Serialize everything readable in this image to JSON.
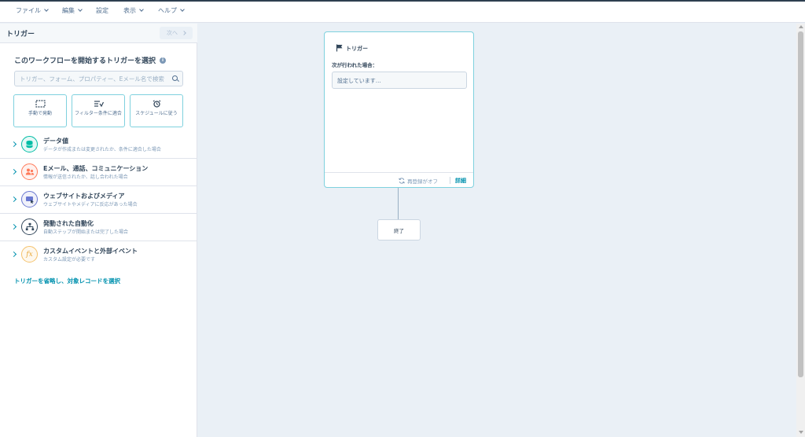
{
  "menu": {
    "file": "ファイル",
    "edit": "編集",
    "settings": "設定",
    "view": "表示",
    "help": "ヘルプ"
  },
  "panel": {
    "title": "トリガー",
    "next_label": "次へ",
    "heading": "このワークフローを開始するトリガーを選択",
    "search_placeholder": "トリガー、フォーム、プロパティー、Eメール名で検索"
  },
  "tiles": [
    {
      "label": "手動で発動",
      "icon": "manual-trigger-icon"
    },
    {
      "label": "フィルター条件に適合",
      "icon": "filter-icon"
    },
    {
      "label": "スケジュールに従う",
      "icon": "alarm-clock-icon"
    }
  ],
  "categories": [
    {
      "title": "データ値",
      "desc": "データが作成または変更されたか、条件に適合した場合",
      "icon": "database-icon",
      "color": "#00bda5"
    },
    {
      "title": "Eメール、通話、コミュニケーション",
      "desc": "情報が送信されたか、話し合われた場合",
      "icon": "people-icon",
      "color": "#ff7a59"
    },
    {
      "title": "ウェブサイトおよびメディア",
      "desc": "ウェブサイトやメディアに反応があった場合",
      "icon": "website-icon",
      "color": "#6a78d1"
    },
    {
      "title": "発動された自動化",
      "desc": "自動ステップが開始または完了した場合",
      "icon": "workflow-icon",
      "color": "#33475b"
    },
    {
      "title": "カスタムイベントと外部イベント",
      "desc": "カスタム設定が必要です",
      "icon": "function-icon",
      "color": "#f5c26b"
    }
  ],
  "skip_link": "トリガーを省略し、対象レコードを選択",
  "canvas": {
    "card_title": "トリガー",
    "card_label": "次が行われた場合：",
    "card_box_text": "設定しています…",
    "reenroll_label": "再登録がオフ",
    "details_label": "詳細",
    "end_label": "終了"
  }
}
